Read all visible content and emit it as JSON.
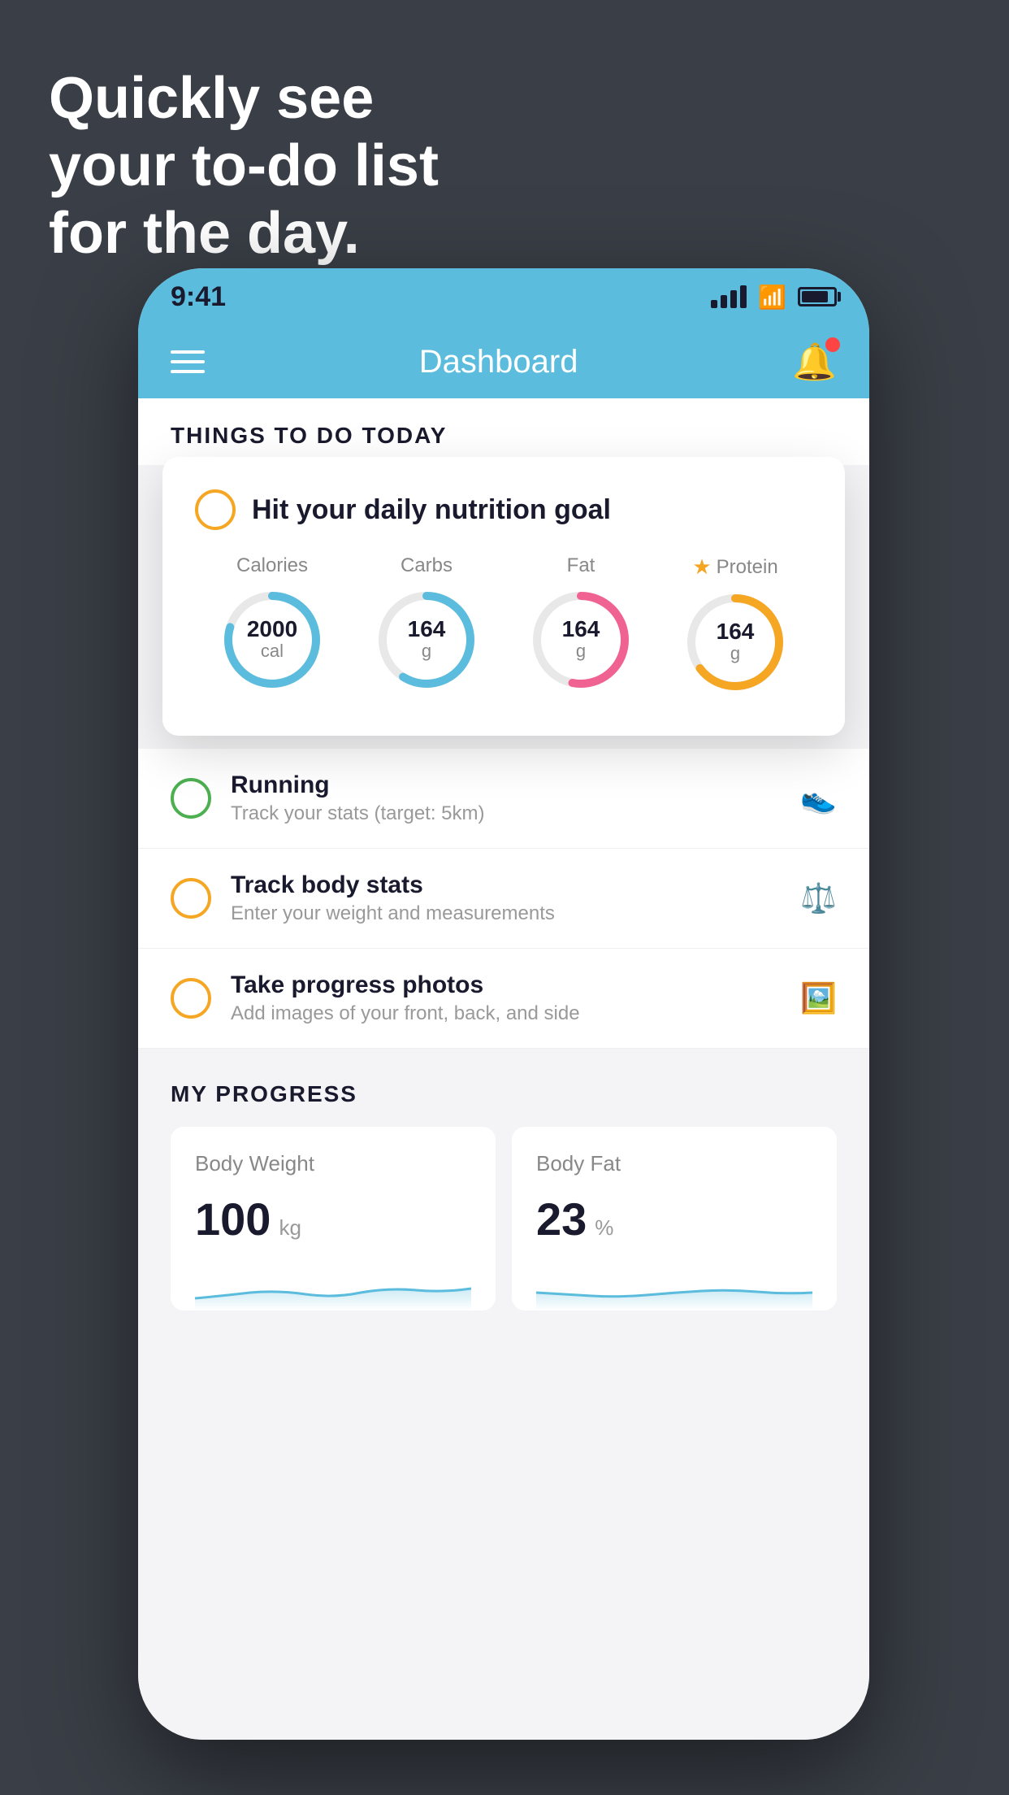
{
  "background": {
    "headline_line1": "Quickly see",
    "headline_line2": "your to-do list",
    "headline_line3": "for the day."
  },
  "statusBar": {
    "time": "9:41"
  },
  "navBar": {
    "title": "Dashboard"
  },
  "thingsToDo": {
    "sectionTitle": "THINGS TO DO TODAY",
    "nutritionCard": {
      "title": "Hit your daily nutrition goal",
      "calories": {
        "label": "Calories",
        "value": "2000",
        "unit": "cal"
      },
      "carbs": {
        "label": "Carbs",
        "value": "164",
        "unit": "g"
      },
      "fat": {
        "label": "Fat",
        "value": "164",
        "unit": "g"
      },
      "protein": {
        "label": "Protein",
        "value": "164",
        "unit": "g"
      }
    },
    "items": [
      {
        "title": "Running",
        "subtitle": "Track your stats (target: 5km)",
        "status": "green",
        "icon": "shoe"
      },
      {
        "title": "Track body stats",
        "subtitle": "Enter your weight and measurements",
        "status": "yellow",
        "icon": "scale"
      },
      {
        "title": "Take progress photos",
        "subtitle": "Add images of your front, back, and side",
        "status": "yellow",
        "icon": "portrait"
      }
    ]
  },
  "myProgress": {
    "sectionTitle": "MY PROGRESS",
    "bodyWeight": {
      "label": "Body Weight",
      "value": "100",
      "unit": "kg"
    },
    "bodyFat": {
      "label": "Body Fat",
      "value": "23",
      "unit": "%"
    }
  }
}
